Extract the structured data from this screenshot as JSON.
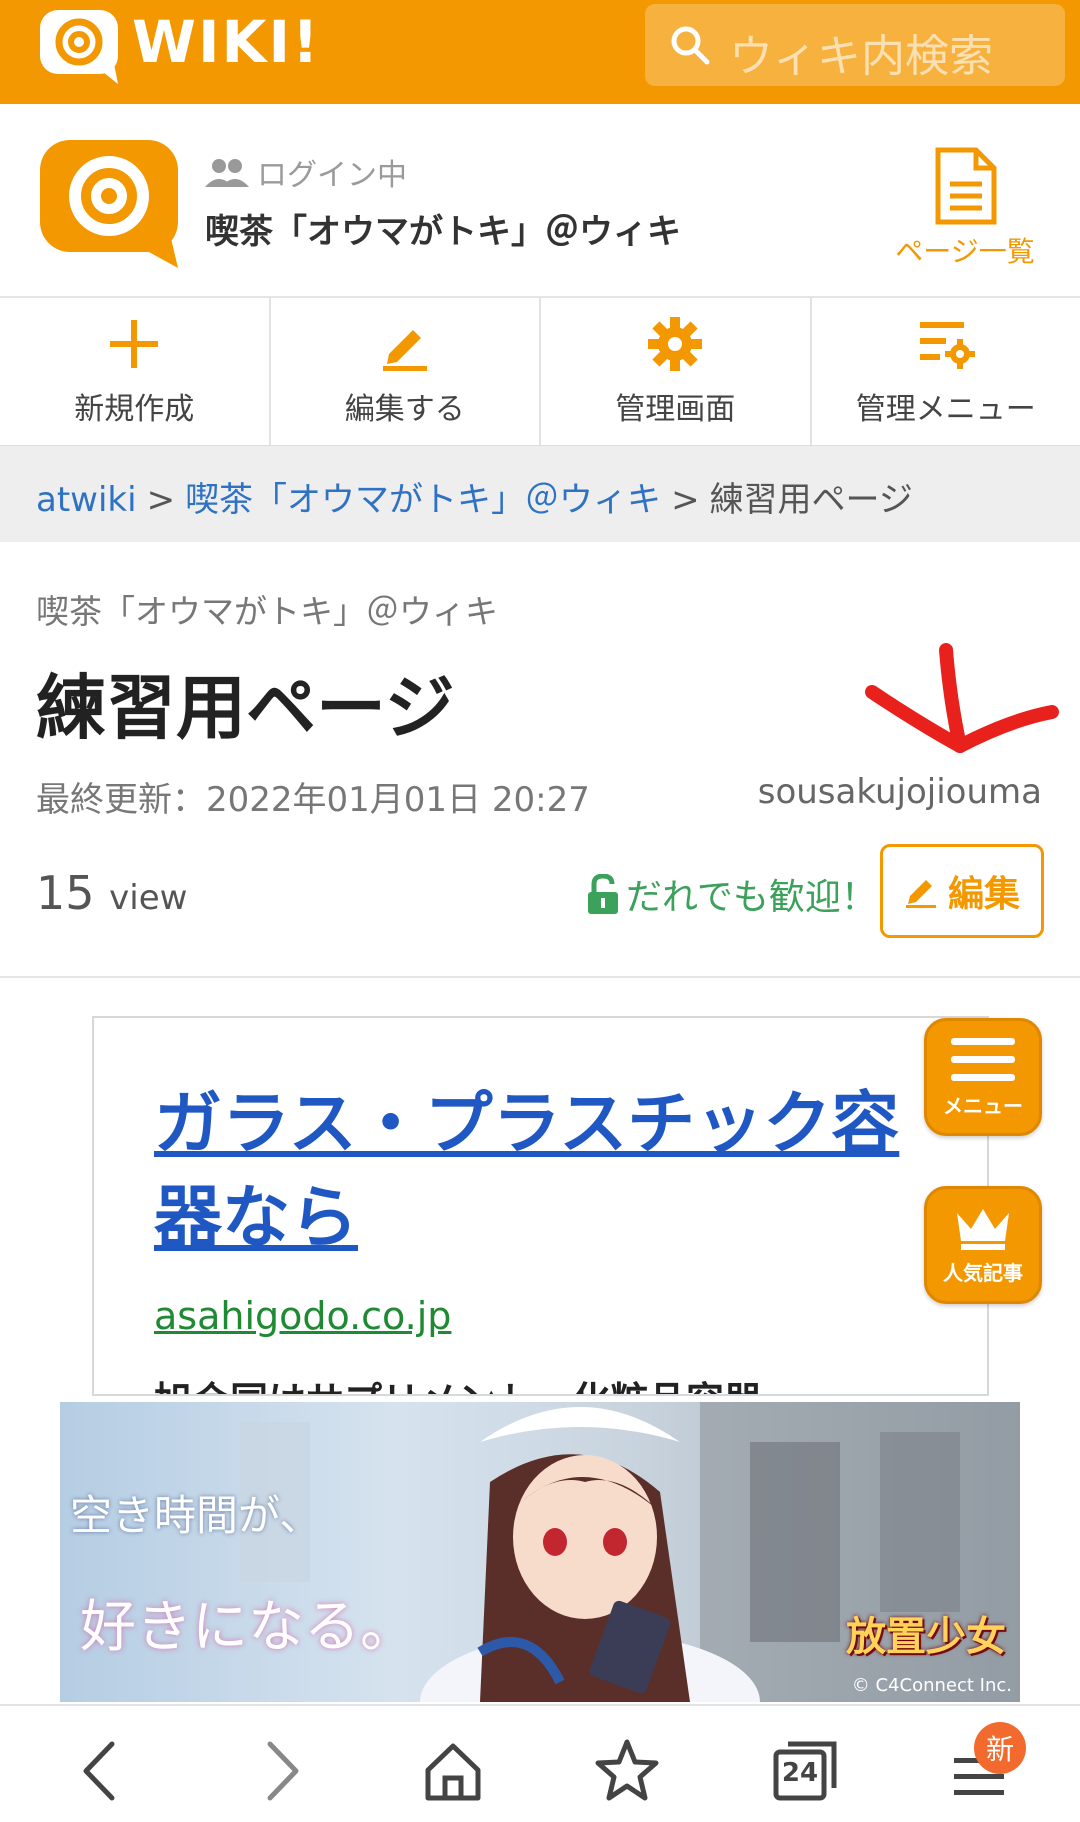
{
  "topbar": {
    "logo_text": "WIKI!",
    "search_placeholder": "ウィキ内検索"
  },
  "wiki_header": {
    "login_status": "ログイン中",
    "wiki_name": "喫茶「オウマがトキ」＠ウィキ",
    "page_list_label": "ページ一覧"
  },
  "actions": [
    {
      "label": "新規作成",
      "icon": "plus-icon"
    },
    {
      "label": "編集する",
      "icon": "pencil-icon"
    },
    {
      "label": "管理画面",
      "icon": "gear-icon"
    },
    {
      "label": "管理メニュー",
      "icon": "settings-menu-icon"
    }
  ],
  "breadcrumb": {
    "root": "atwiki",
    "sep": ">",
    "wiki": "喫茶「オウマがトキ」＠ウィキ",
    "current": "練習用ページ"
  },
  "page": {
    "wiki_small": "喫茶「オウマがトキ」＠ウィキ",
    "title": "練習用ページ",
    "updated": "最終更新：2022年01月01日 20:27",
    "author": "sousakujojiouma",
    "view_count": "15",
    "view_unit": "view",
    "welcome": "だれでも歓迎！",
    "edit_label": "編集"
  },
  "ad": {
    "title": "ガラス・プラスチック容器なら",
    "domain": "asahigodo.co.jp",
    "description": "旭合同はサプリメント・化粧品容器"
  },
  "floating": {
    "menu_label": "メニュー",
    "popular_label": "人気記事"
  },
  "banner": {
    "line1": "空き時間が、",
    "line2": "好きになる。",
    "game": "放置少女",
    "copyright": "© C4Connect Inc."
  },
  "bottom_nav": {
    "tab_count": "24",
    "badge": "新"
  },
  "colors": {
    "brand": "#f39800",
    "link": "#2f72c4",
    "green": "#3ca15a"
  }
}
